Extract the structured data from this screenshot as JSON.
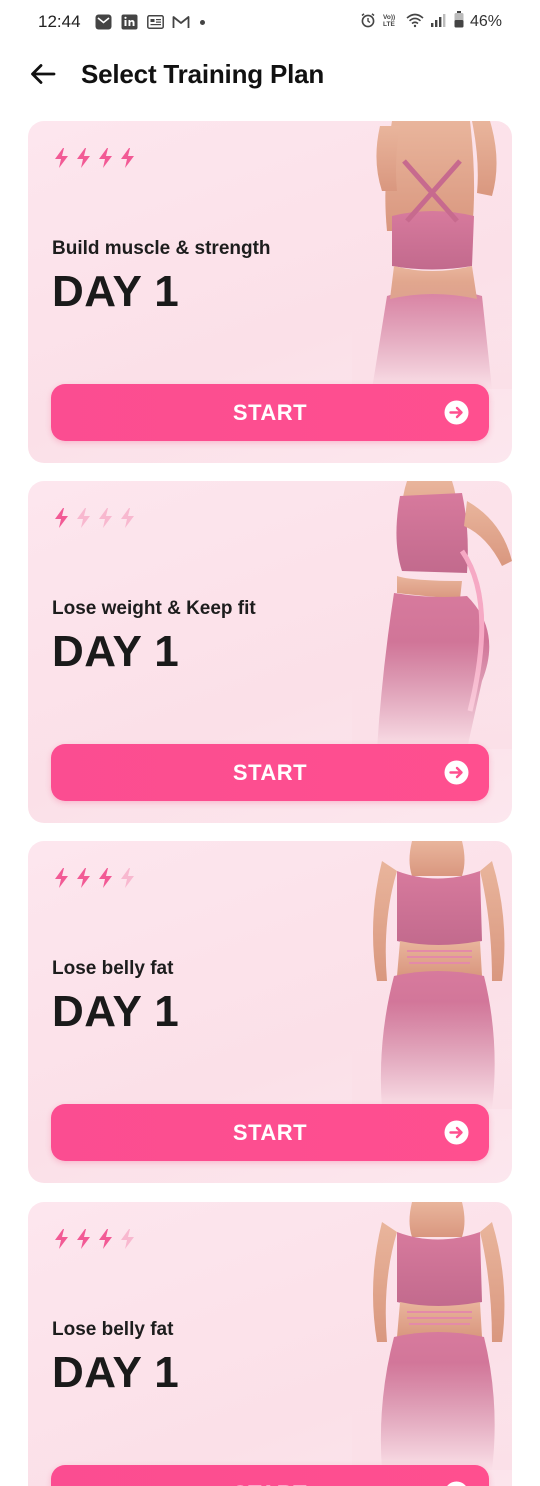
{
  "status_bar": {
    "time": "12:44",
    "battery": "46%",
    "left_icons": [
      "mail-icon",
      "linkedin-icon",
      "news-icon",
      "gmail-icon"
    ],
    "right_icons": [
      "alarm-icon",
      "volte-icon",
      "wifi-icon",
      "signal-icon",
      "battery-icon"
    ]
  },
  "header": {
    "title": "Select Training Plan",
    "back_icon": "arrow-left-icon"
  },
  "colors": {
    "accent": "#ff4f8f",
    "card_bg": "#fbe0e8",
    "bolt_active": "#f25a95",
    "bolt_inactive": "#f8b8cf"
  },
  "plans": [
    {
      "subtitle": "Build muscle & strength",
      "day": "DAY 1",
      "intensity": 4,
      "intensity_max": 4,
      "button": "START"
    },
    {
      "subtitle": "Lose weight & Keep fit",
      "day": "DAY 1",
      "intensity": 1,
      "intensity_max": 4,
      "button": "START"
    },
    {
      "subtitle": "Lose belly fat",
      "day": "DAY 1",
      "intensity": 3,
      "intensity_max": 4,
      "button": "START"
    },
    {
      "subtitle": "Lose belly fat",
      "day": "DAY 1",
      "intensity": 3,
      "intensity_max": 4,
      "button": "START"
    }
  ]
}
